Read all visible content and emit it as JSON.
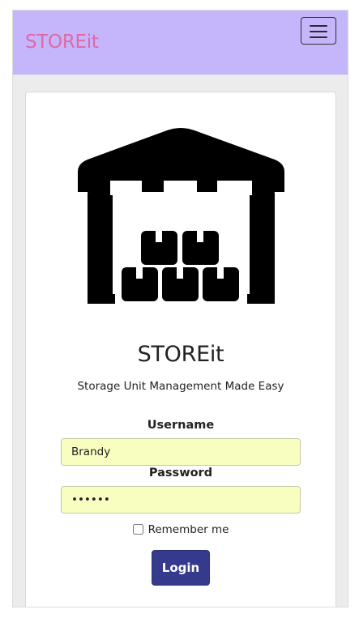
{
  "navbar": {
    "brand": "STOREit",
    "menu_icon": "hamburger-menu-icon",
    "background_color": "#c5b5fa",
    "brand_color": "#e069a8"
  },
  "login_card": {
    "logo_icon": "warehouse-icon",
    "title": "STOREit",
    "tagline": "Storage Unit Management Made Easy",
    "username": {
      "label": "Username",
      "value": "Brandy"
    },
    "password": {
      "label": "Password",
      "value": "••••••"
    },
    "remember_me": {
      "label": "Remember me",
      "checked": false
    },
    "login_button": {
      "label": "Login",
      "color": "#353a8d"
    },
    "input_background": "#f8fdc0"
  }
}
